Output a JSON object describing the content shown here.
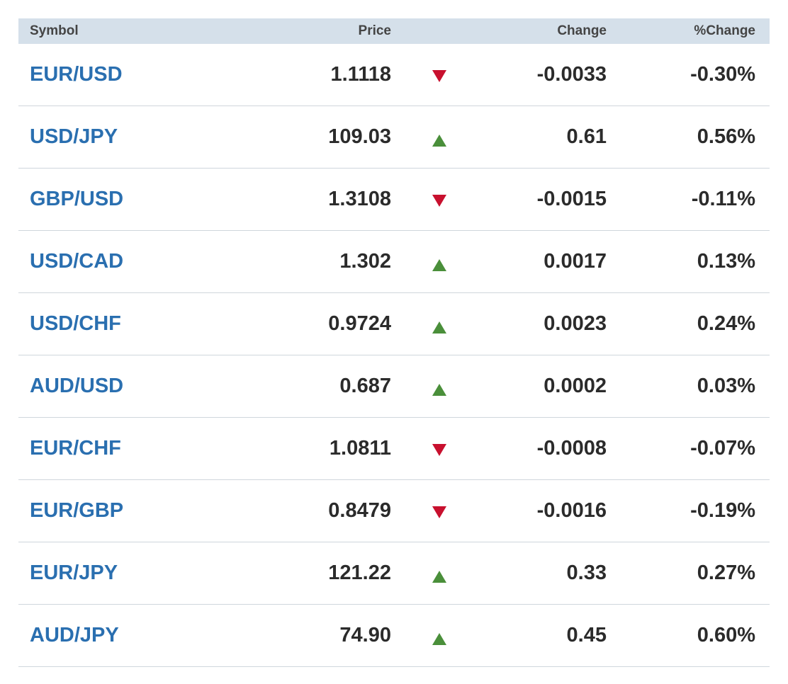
{
  "table": {
    "headers": {
      "symbol": "Symbol",
      "price": "Price",
      "change": "Change",
      "pct_change": "%Change"
    },
    "colors": {
      "header_bg": "#d5e0ea",
      "symbol_link": "#2a6fb0",
      "up": "#4a8f3a",
      "down": "#c8102e"
    },
    "rows": [
      {
        "symbol": "EUR/USD",
        "price": "1.1118",
        "direction": "down",
        "icon": "down-arrow-icon",
        "change": "-0.0033",
        "pct_change": "-0.30%"
      },
      {
        "symbol": "USD/JPY",
        "price": "109.03",
        "direction": "up",
        "icon": "up-arrow-icon",
        "change": "0.61",
        "pct_change": "0.56%"
      },
      {
        "symbol": "GBP/USD",
        "price": "1.3108",
        "direction": "down",
        "icon": "down-arrow-icon",
        "change": "-0.0015",
        "pct_change": "-0.11%"
      },
      {
        "symbol": "USD/CAD",
        "price": "1.302",
        "direction": "up",
        "icon": "up-arrow-icon",
        "change": "0.0017",
        "pct_change": "0.13%"
      },
      {
        "symbol": "USD/CHF",
        "price": "0.9724",
        "direction": "up",
        "icon": "up-arrow-icon",
        "change": "0.0023",
        "pct_change": "0.24%"
      },
      {
        "symbol": "AUD/USD",
        "price": "0.687",
        "direction": "up",
        "icon": "up-arrow-icon",
        "change": "0.0002",
        "pct_change": "0.03%"
      },
      {
        "symbol": "EUR/CHF",
        "price": "1.0811",
        "direction": "down",
        "icon": "down-arrow-icon",
        "change": "-0.0008",
        "pct_change": "-0.07%"
      },
      {
        "symbol": "EUR/GBP",
        "price": "0.8479",
        "direction": "down",
        "icon": "down-arrow-icon",
        "change": "-0.0016",
        "pct_change": "-0.19%"
      },
      {
        "symbol": "EUR/JPY",
        "price": "121.22",
        "direction": "up",
        "icon": "up-arrow-icon",
        "change": "0.33",
        "pct_change": "0.27%"
      },
      {
        "symbol": "AUD/JPY",
        "price": "74.90",
        "direction": "up",
        "icon": "up-arrow-icon",
        "change": "0.45",
        "pct_change": "0.60%"
      }
    ]
  }
}
